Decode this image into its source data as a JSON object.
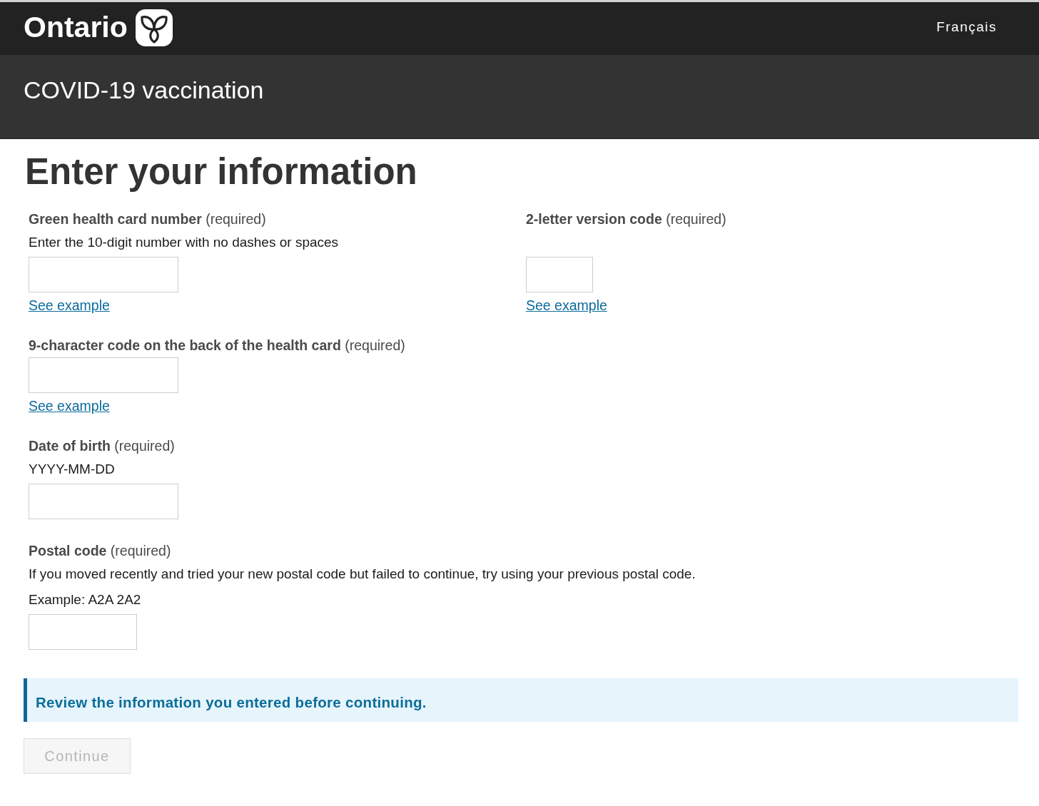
{
  "header": {
    "logo": "Ontario",
    "language_link": "Français"
  },
  "banner": {
    "title": "COVID-19 vaccination"
  },
  "heading": "Enter your information",
  "form": {
    "rows": [
      {
        "fields": [
          {
            "label": "**Green health card number** (required)",
            "hints": [
              "Enter the 10-digit number with no dashes or spaces"
            ],
            "link": "See example"
          },
          {
            "label": "**2-letter version code** (required)",
            "link": "See example"
          }
        ]
      },
      {
        "fields": [
          {
            "label": "**9-character code on the back of the health card** (required)",
            "link": "See example"
          }
        ]
      },
      {
        "fields": [
          {
            "label": "**Date of birth** (required)",
            "hints": [
              "YYYY-MM-DD"
            ]
          }
        ]
      },
      {
        "fields": [
          {
            "label": "**Postal code** (required)",
            "hints": [
              "If you moved recently and tried your new postal code but failed to continue, try using your previous postal code.",
              "Example: A2A 2A2"
            ]
          }
        ]
      }
    ]
  },
  "alert": {
    "message": "Review the information you entered before continuing."
  },
  "continue_button": {
    "label": "Continue",
    "disabled": true
  }
}
